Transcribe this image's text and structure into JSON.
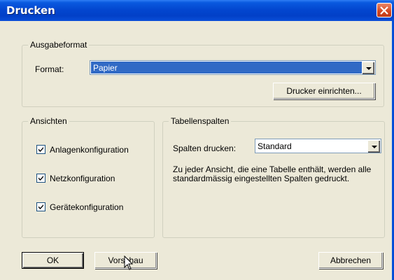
{
  "window": {
    "title": "Drucken"
  },
  "ausgabeformat": {
    "legend": "Ausgabeformat",
    "format_label": "Format:",
    "format_value": "Papier",
    "printer_setup_button": "Drucker einrichten..."
  },
  "ansichten": {
    "legend": "Ansichten",
    "items": [
      {
        "label": "Anlagenkonfiguration",
        "checked": true
      },
      {
        "label": "Netzkonfiguration",
        "checked": true
      },
      {
        "label": "Gerätekonfiguration",
        "checked": true
      }
    ]
  },
  "tabellenspalten": {
    "legend": "Tabellenspalten",
    "columns_label": "Spalten drucken:",
    "columns_value": "Standard",
    "description": "Zu jeder Ansicht, die eine Tabelle enthält, werden alle standardmässig eingestellten Spalten gedruckt."
  },
  "buttons": {
    "ok": "OK",
    "preview": "Vorschau",
    "cancel": "Abbrechen"
  },
  "icons": {
    "close": "close-icon",
    "checkmark": "checkmark-icon",
    "dropdown": "chevron-down-icon",
    "cursor": "mouse-pointer-icon"
  }
}
